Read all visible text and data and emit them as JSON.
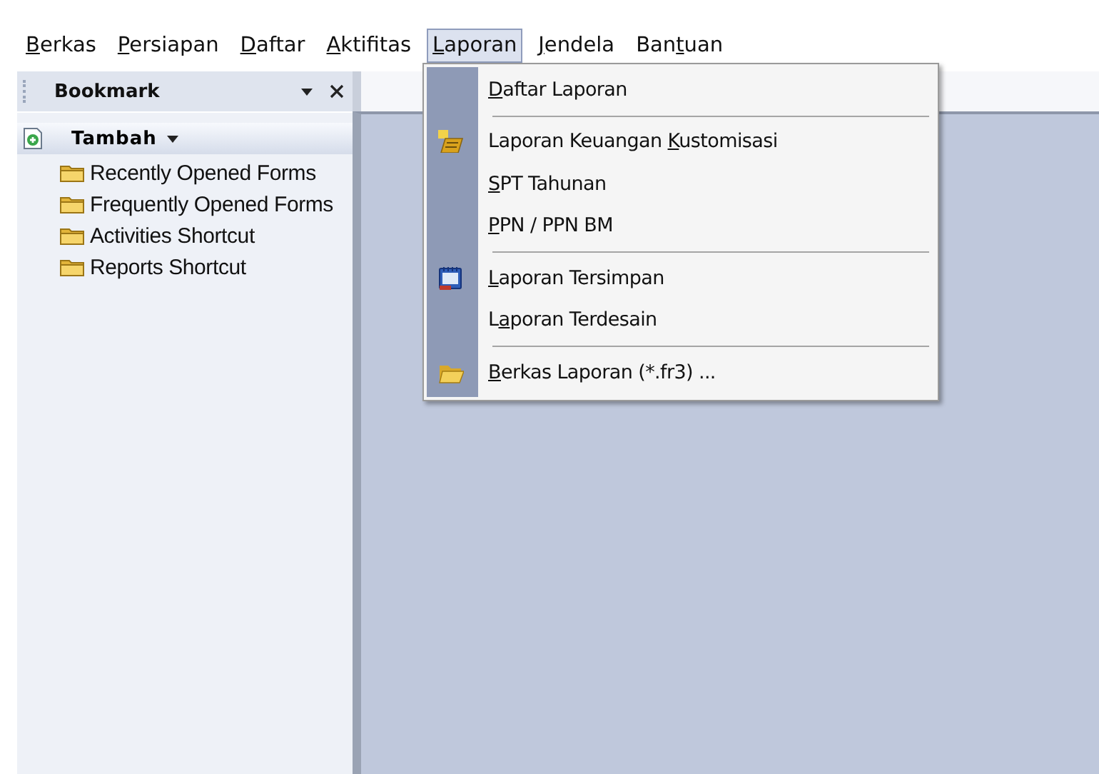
{
  "menu_bar": [
    {
      "key": "B",
      "post": "erkas",
      "selected": false
    },
    {
      "key": "P",
      "post": "ersiapan",
      "selected": false
    },
    {
      "key": "D",
      "post": "aftar",
      "selected": false
    },
    {
      "key": "A",
      "post": "ktifitas",
      "selected": false
    },
    {
      "key": "L",
      "post": "aporan",
      "selected": true
    },
    {
      "key": "J",
      "post": "endela",
      "selected": false
    },
    {
      "pre": "Ban",
      "key": "t",
      "post": "uan",
      "selected": false
    }
  ],
  "dropdown": [
    {
      "kind": "plain",
      "key": "D",
      "post": "aftar Laporan"
    },
    {
      "kind": "separator"
    },
    {
      "kind": "report",
      "pre": "Laporan Keuangan ",
      "key": "K",
      "post": "ustomisasi"
    },
    {
      "kind": "plain",
      "key": "S",
      "post": "PT Tahunan"
    },
    {
      "kind": "plain",
      "key": "P",
      "post": "PN / PPN BM"
    },
    {
      "kind": "separator"
    },
    {
      "kind": "calendar",
      "key": "L",
      "post": "aporan Tersimpan"
    },
    {
      "kind": "plain",
      "pre": "L",
      "key": "a",
      "post": "poran Terdesain"
    },
    {
      "kind": "separator"
    },
    {
      "kind": "folder",
      "key": "B",
      "post": "erkas Laporan (*.fr3) ..."
    }
  ],
  "sidebar": {
    "title": "Bookmark",
    "add_button": "Tambah",
    "items": [
      "Recently Opened Forms",
      "Frequently Opened Forms",
      "Activities Shortcut",
      "Reports Shortcut"
    ]
  }
}
